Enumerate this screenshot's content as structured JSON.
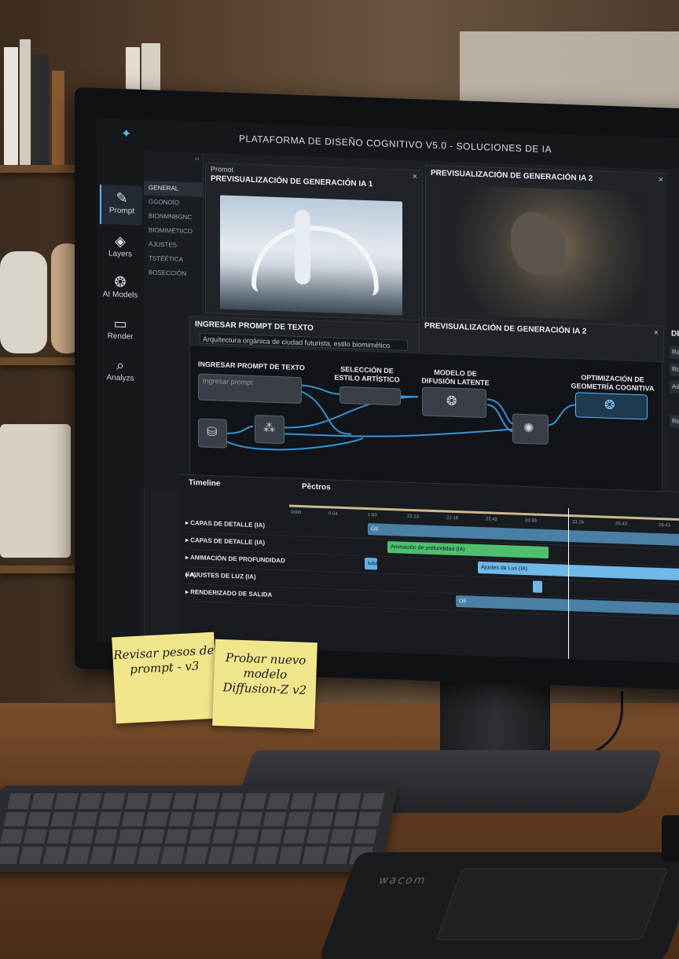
{
  "app": {
    "title": "PLATAFORMA DE DISEÑO COGNITIVO V5.0 - SOLUCIONES DE IA",
    "accent": "#57b8ff"
  },
  "rail": [
    {
      "label": "Prompt",
      "icon": "edit-icon"
    },
    {
      "label": "Layers",
      "icon": "layers-icon"
    },
    {
      "label": "AI Models",
      "icon": "brain-icon"
    },
    {
      "label": "Render",
      "icon": "video-icon"
    },
    {
      "label": "Analyzs",
      "icon": "search-icon"
    }
  ],
  "submenu": {
    "collapse": "‹‹",
    "items": [
      "GENERAL",
      "GGONOÍO",
      "BIONMNBGNC",
      "BIOMIMÉTIICO",
      "AJUSTES",
      "TSTÉÉTICA",
      "BOSECCIÓN"
    ]
  },
  "panels": {
    "prompt_tab": "Promot",
    "preview1_title": "PREVISUALIZACIÓN DE GENERACIÓN IA 1",
    "preview2_title": "PREVISUALIZACIÓN DE GENERACIÓN IA 2",
    "preview3_title": "PREVISUALIZACIÓN DE GENERACIÓN IA 2",
    "prompt_input_title": "INGRESAR PROMPT DE TEXTO",
    "prompt_input_value": "Arquitectura orgánica de ciudad futurista, estilo biomimético",
    "close": "×"
  },
  "nodes": {
    "input_title": "INGRESAR PROMPT DE TEXTO",
    "input_placeholder": "Ingresar prompt",
    "style_title": "SELECCIÓN DE ESTILO ARTÍSTICO",
    "diffusion_title": "MODELO DE DIFUSIÓN LATENTE",
    "optim_title": "OPTIMIZACIÓN DE GEOMETRÍA COGNITIVA"
  },
  "timeline": {
    "title": "Timeline",
    "tracks_header": "Pěctros",
    "ruler": [
      "0000",
      "0.04",
      "1:00",
      "22.13",
      "22.18",
      "22.42",
      "33.39",
      "33.16",
      "26.43",
      "26.43"
    ],
    "tracks": [
      "CAPAS DE DETALLE (IA)",
      "CAPAS DE DETALLE (IA)",
      "ANIMACIÓN DE PROFUNDIDAD (IA)",
      "AJUSTES DE LUZ (IA)",
      "RENDERIZADO DE SALIDA"
    ],
    "clips": {
      "c1": "G6",
      "c2": "Animación de profundidad (IA)",
      "c3_small": "ЫЫЫ",
      "c4": "Ajustes de Lus (IA)",
      "c5": "O6"
    }
  },
  "right_panel": {
    "header": "DE",
    "items": [
      "Ran",
      "Rod",
      "Adic",
      "Resh"
    ]
  },
  "notes": {
    "note1": "Revisar pesos de prompt - v3",
    "note2": "Probar nuevo modelo Diffusion-Z v2"
  },
  "tablet_brand": "wacom"
}
